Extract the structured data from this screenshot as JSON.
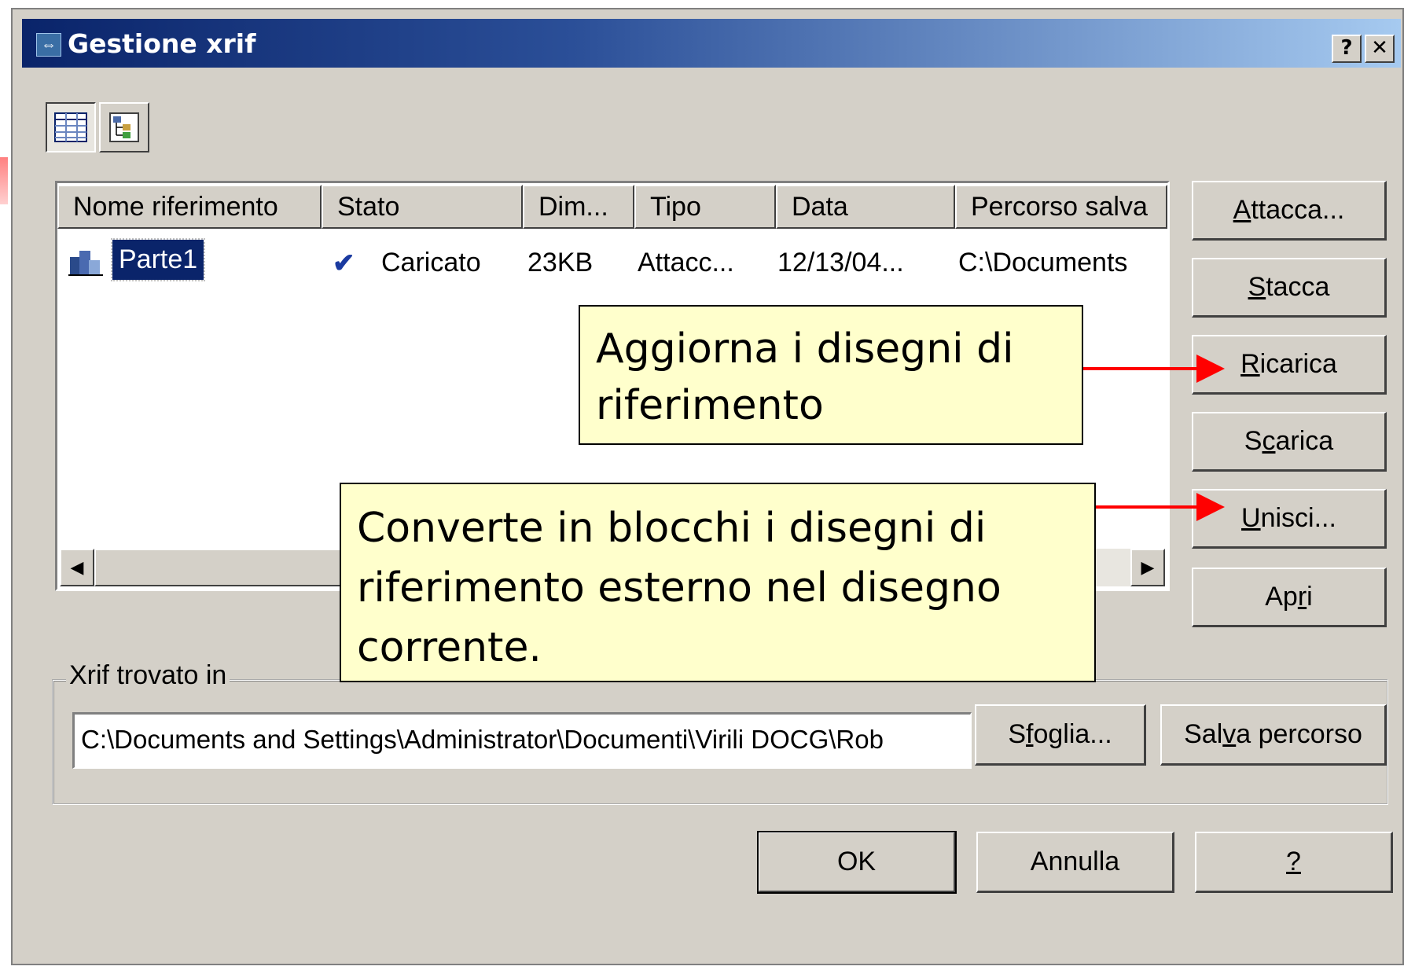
{
  "window": {
    "title": "Gestione xrif",
    "help_btn": "?",
    "close_btn": "✕"
  },
  "list": {
    "columns": [
      "Nome riferimento",
      "Stato",
      "Dim...",
      "Tipo",
      "Data",
      "Percorso salva"
    ],
    "rows": [
      {
        "name": "Parte1",
        "status_check": "✔",
        "status": "Caricato",
        "size": "23KB",
        "type": "Attacc...",
        "date": "12/13/04...",
        "path": "C:\\Documents"
      }
    ],
    "scroll_left": "◀",
    "scroll_right": "▶"
  },
  "side_buttons": {
    "attacca": {
      "u": "A",
      "rest": "ttacca..."
    },
    "stacca": {
      "u": "S",
      "rest": "tacca"
    },
    "ricarica": {
      "u": "R",
      "rest": "icarica"
    },
    "scarica": {
      "pre": "S",
      "u": "c",
      "rest": "arica"
    },
    "unisci": {
      "u": "U",
      "rest": "nisci..."
    },
    "apri": {
      "pre": "Ap",
      "u": "r",
      "rest": "i"
    }
  },
  "found_in": {
    "label": "Xrif trovato in",
    "path": "C:\\Documents and Settings\\Administrator\\Documenti\\Virili DOCG\\Rob",
    "browse": {
      "pre": "S",
      "u": "f",
      "rest": "oglia..."
    },
    "save_path": {
      "pre": "Sal",
      "u": "v",
      "rest": "a percorso"
    }
  },
  "footer": {
    "ok": "OK",
    "cancel": "Annulla",
    "help": "?"
  },
  "callouts": {
    "ricarica": "Aggiorna i disegni di riferimento",
    "unisci": "Converte in blocchi i disegni di riferimento esterno nel disegno corrente."
  },
  "colors": {
    "dialog_bg": "#d4d0c8",
    "title_gradient_start": "#0a246a",
    "callout_bg": "#ffffcc",
    "arrow": "#ff0000"
  }
}
